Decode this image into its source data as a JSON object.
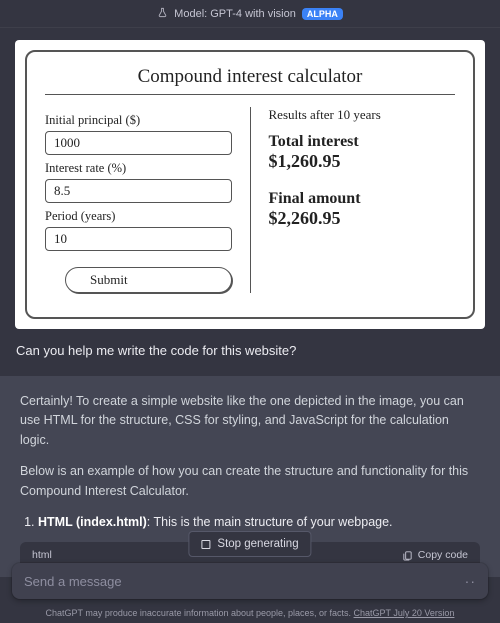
{
  "header": {
    "model_label": "Model: GPT-4 with vision",
    "badge": "ALPHA"
  },
  "mockup": {
    "title": "Compound interest calculator",
    "fields": {
      "principal_label": "Initial principal ($)",
      "principal_value": "1000",
      "rate_label": "Interest rate (%)",
      "rate_value": "8.5",
      "period_label": "Period (years)",
      "period_value": "10",
      "submit_label": "Submit"
    },
    "results": {
      "heading": "Results after 10 years",
      "total_interest_label": "Total interest",
      "total_interest_value": "$1,260.95",
      "final_amount_label": "Final amount",
      "final_amount_value": "$2,260.95"
    }
  },
  "user_message": "Can you help me write the code for this website?",
  "assistant": {
    "para1": "Certainly! To create a simple website like the one depicted in the image, you can use HTML for the structure, CSS for styling, and JavaScript for the calculation logic.",
    "para2": "Below is an example of how you can create the structure and functionality for this Compound Interest Calculator.",
    "list_item_bold": "HTML (index.html)",
    "list_item_rest": ": This is the main structure of your webpage.",
    "code_lang": "html",
    "copy_label": "Copy code"
  },
  "controls": {
    "stop_label": "Stop generating",
    "input_placeholder": "Send a message"
  },
  "footer": {
    "note_prefix": "ChatGPT may produce inaccurate information about people, places, or facts. ",
    "version": "ChatGPT July 20 Version"
  }
}
